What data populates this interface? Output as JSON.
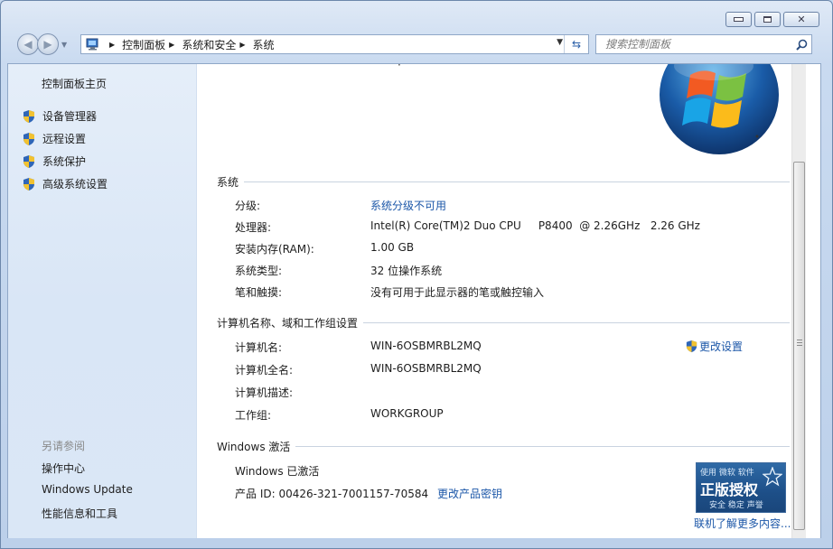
{
  "window": {
    "caption": {
      "minimize": "minimize",
      "maximize": "maximize",
      "close": "close"
    }
  },
  "address": {
    "crumbs": [
      "控制面板",
      "系统和安全",
      "系统"
    ]
  },
  "search": {
    "placeholder": "搜索控制面板"
  },
  "sidebar": {
    "home": "控制面板主页",
    "tasks": [
      "设备管理器",
      "远程设置",
      "系统保护",
      "高级系统设置"
    ],
    "see_also_title": "另请参阅",
    "see_also": [
      "操作中心",
      "Windows Update",
      "性能信息和工具"
    ]
  },
  "system": {
    "title": "系统",
    "rating_label": "分级:",
    "rating_value": "系统分级不可用",
    "processor_label": "处理器:",
    "processor_value": "Intel(R) Core(TM)2 Duo CPU     P8400  @ 2.26GHz   2.26 GHz",
    "ram_label": "安装内存(RAM):",
    "ram_value": "1.00 GB",
    "type_label": "系统类型:",
    "type_value": "32 位操作系统",
    "pen_label": "笔和触摸:",
    "pen_value": "没有可用于此显示器的笔或触控输入"
  },
  "computer": {
    "title": "计算机名称、域和工作组设置",
    "name_label": "计算机名:",
    "name_value": "WIN-6OSBMRBL2MQ",
    "fullname_label": "计算机全名:",
    "fullname_value": "WIN-6OSBMRBL2MQ",
    "desc_label": "计算机描述:",
    "desc_value": "",
    "workgroup_label": "工作组:",
    "workgroup_value": "WORKGROUP",
    "change_settings": "更改设置"
  },
  "activation": {
    "title": "Windows 激活",
    "status": "Windows 已激活",
    "product_id_label": "产品 ID: 00426-321-7001157-70584",
    "change_key": "更改产品密钥",
    "genuine_line1": "使用 微软 软件",
    "genuine_line2": "正版授权",
    "genuine_line3": "安全 稳定 声誉",
    "more_online": "联机了解更多内容..."
  },
  "colors": {
    "link": "#1c57a8",
    "sidebar_bg": "#dae7f6",
    "genuine_bg": "#1d4f88"
  }
}
